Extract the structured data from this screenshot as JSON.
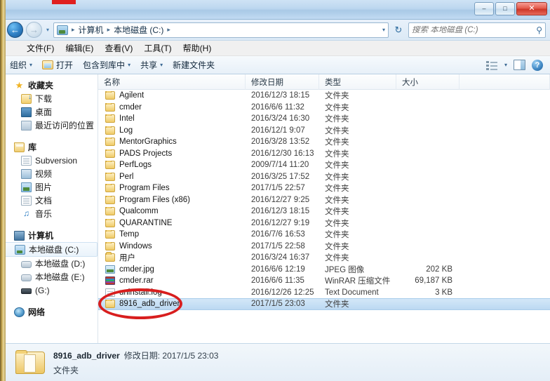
{
  "window": {
    "controls": {
      "minimize": "–",
      "maximize": "□",
      "close": "✕"
    }
  },
  "address": {
    "back_icon": "←",
    "forward_icon": "→",
    "history_caret": "▾",
    "computer_icon": "computer-drive-icon",
    "crumbs": [
      "计算机",
      "本地磁盘 (C:)"
    ],
    "separator": "▸",
    "dropdown_caret": "▾",
    "refresh_icon": "↻",
    "search_placeholder": "搜索 本地磁盘 (C:)",
    "search_value": "",
    "search_icon": "⚲"
  },
  "menubar": {
    "items": [
      "文件(F)",
      "编辑(E)",
      "查看(V)",
      "工具(T)",
      "帮助(H)"
    ]
  },
  "toolbar": {
    "organize": "组织",
    "open": "打开",
    "include_in_library": "包含到库中",
    "share": "共享",
    "new_folder": "新建文件夹",
    "caret": "▾",
    "help_glyph": "?"
  },
  "sidebar": {
    "groups": [
      {
        "head": {
          "label": "收藏夹",
          "icon": "star-icon"
        },
        "items": [
          {
            "label": "下载",
            "icon": "downloads-icon"
          },
          {
            "label": "桌面",
            "icon": "desktop-icon"
          },
          {
            "label": "最近访问的位置",
            "icon": "recent-places-icon"
          }
        ]
      },
      {
        "head": {
          "label": "库",
          "icon": "library-icon"
        },
        "items": [
          {
            "label": "Subversion",
            "icon": "document-icon"
          },
          {
            "label": "视频",
            "icon": "video-icon"
          },
          {
            "label": "图片",
            "icon": "pictures-icon"
          },
          {
            "label": "文档",
            "icon": "document-icon"
          },
          {
            "label": "音乐",
            "icon": "music-icon"
          }
        ]
      },
      {
        "head": {
          "label": "计算机",
          "icon": "computer-icon"
        },
        "items": [
          {
            "label": "本地磁盘 (C:)",
            "icon": "hard-drive-system-icon",
            "selected": true
          },
          {
            "label": "本地磁盘 (D:)",
            "icon": "hard-drive-icon"
          },
          {
            "label": "本地磁盘 (E:)",
            "icon": "hard-drive-icon"
          },
          {
            "label": "(G:)",
            "icon": "usb-drive-icon"
          }
        ]
      },
      {
        "head": {
          "label": "网络",
          "icon": "network-icon"
        },
        "items": []
      }
    ]
  },
  "filelist": {
    "columns": [
      {
        "key": "name",
        "label": "名称"
      },
      {
        "key": "date",
        "label": "修改日期"
      },
      {
        "key": "type",
        "label": "类型"
      },
      {
        "key": "size",
        "label": "大小"
      }
    ],
    "rows": [
      {
        "name": "Agilent",
        "date": "2016/12/3 18:15",
        "type": "文件夹",
        "size": "",
        "icon": "folder-icon"
      },
      {
        "name": "cmder",
        "date": "2016/6/6 11:32",
        "type": "文件夹",
        "size": "",
        "icon": "folder-icon"
      },
      {
        "name": "Intel",
        "date": "2016/3/24 16:30",
        "type": "文件夹",
        "size": "",
        "icon": "folder-icon"
      },
      {
        "name": "Log",
        "date": "2016/12/1 9:07",
        "type": "文件夹",
        "size": "",
        "icon": "folder-icon"
      },
      {
        "name": "MentorGraphics",
        "date": "2016/3/28 13:52",
        "type": "文件夹",
        "size": "",
        "icon": "folder-icon"
      },
      {
        "name": "PADS Projects",
        "date": "2016/12/30 16:13",
        "type": "文件夹",
        "size": "",
        "icon": "folder-icon"
      },
      {
        "name": "PerfLogs",
        "date": "2009/7/14 11:20",
        "type": "文件夹",
        "size": "",
        "icon": "folder-icon"
      },
      {
        "name": "Perl",
        "date": "2016/3/25 17:52",
        "type": "文件夹",
        "size": "",
        "icon": "folder-icon"
      },
      {
        "name": "Program Files",
        "date": "2017/1/5 22:57",
        "type": "文件夹",
        "size": "",
        "icon": "folder-icon"
      },
      {
        "name": "Program Files (x86)",
        "date": "2016/12/27 9:25",
        "type": "文件夹",
        "size": "",
        "icon": "folder-icon"
      },
      {
        "name": "Qualcomm",
        "date": "2016/12/3 18:15",
        "type": "文件夹",
        "size": "",
        "icon": "folder-icon"
      },
      {
        "name": "QUARANTINE",
        "date": "2016/12/27 9:19",
        "type": "文件夹",
        "size": "",
        "icon": "folder-icon"
      },
      {
        "name": "Temp",
        "date": "2016/7/6 16:53",
        "type": "文件夹",
        "size": "",
        "icon": "folder-icon"
      },
      {
        "name": "Windows",
        "date": "2017/1/5 22:58",
        "type": "文件夹",
        "size": "",
        "icon": "folder-icon"
      },
      {
        "name": "用户",
        "date": "2016/3/24 16:37",
        "type": "文件夹",
        "size": "",
        "icon": "folder-icon"
      },
      {
        "name": "cmder.jpg",
        "date": "2016/6/6 12:19",
        "type": "JPEG 图像",
        "size": "202 KB",
        "icon": "jpeg-file-icon"
      },
      {
        "name": "cmder.rar",
        "date": "2016/6/6 11:35",
        "type": "WinRAR 压缩文件",
        "size": "69,187 KB",
        "icon": "rar-file-icon"
      },
      {
        "name": "uninstall.log",
        "date": "2016/12/26 12:25",
        "type": "Text Document",
        "size": "3 KB",
        "icon": "text-file-icon"
      },
      {
        "name": "8916_adb_driver",
        "date": "2017/1/5 23:03",
        "type": "文件夹",
        "size": "",
        "icon": "folder-icon",
        "selected": true
      }
    ]
  },
  "annotation": {
    "shape": "ellipse",
    "color": "#d81e1e",
    "target": "8916_adb_driver"
  },
  "details": {
    "name": "8916_adb_driver",
    "meta": "修改日期: 2017/1/5 23:03",
    "type": "文件夹",
    "icon": "folder-large-icon"
  }
}
